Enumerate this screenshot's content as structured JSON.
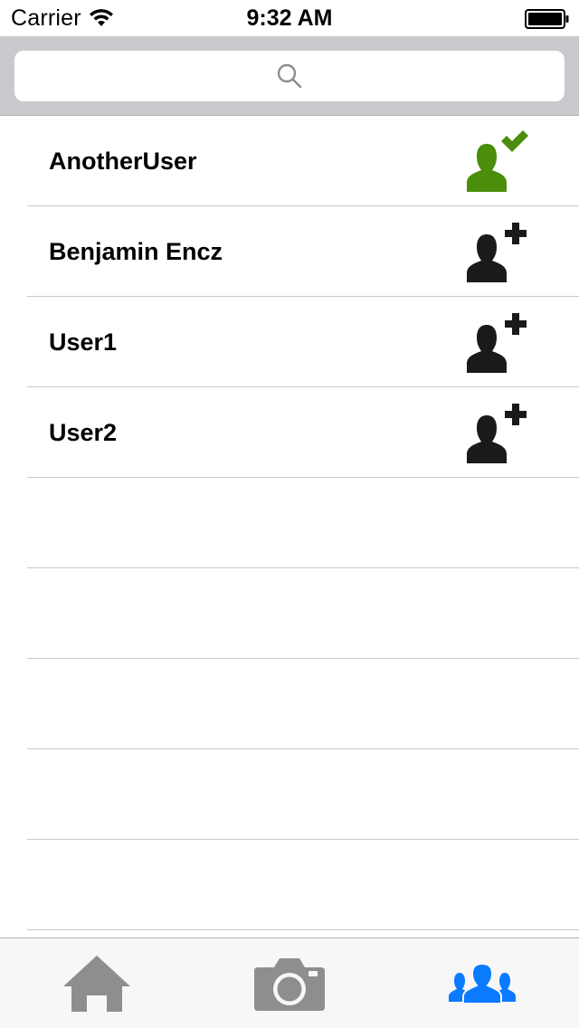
{
  "status_bar": {
    "carrier": "Carrier",
    "time": "9:32 AM"
  },
  "search": {
    "placeholder": "",
    "icon": "search-icon"
  },
  "users": [
    {
      "name": "AnotherUser",
      "status": "added",
      "icon": "user-check-icon"
    },
    {
      "name": "Benjamin Encz",
      "status": "not-added",
      "icon": "user-add-icon"
    },
    {
      "name": "User1",
      "status": "not-added",
      "icon": "user-add-icon"
    },
    {
      "name": "User2",
      "status": "not-added",
      "icon": "user-add-icon"
    }
  ],
  "empty_rows": 5,
  "tab_bar": {
    "tabs": [
      {
        "icon": "home-icon",
        "selected": false
      },
      {
        "icon": "camera-icon",
        "selected": false
      },
      {
        "icon": "friends-icon",
        "selected": true
      }
    ]
  },
  "colors": {
    "added_green": "#4a8e0c",
    "icon_dark": "#1a1a1a",
    "tab_inactive": "#8e8e8e",
    "tab_active": "#0a7aff",
    "search_bg": "#c9c9ce"
  }
}
